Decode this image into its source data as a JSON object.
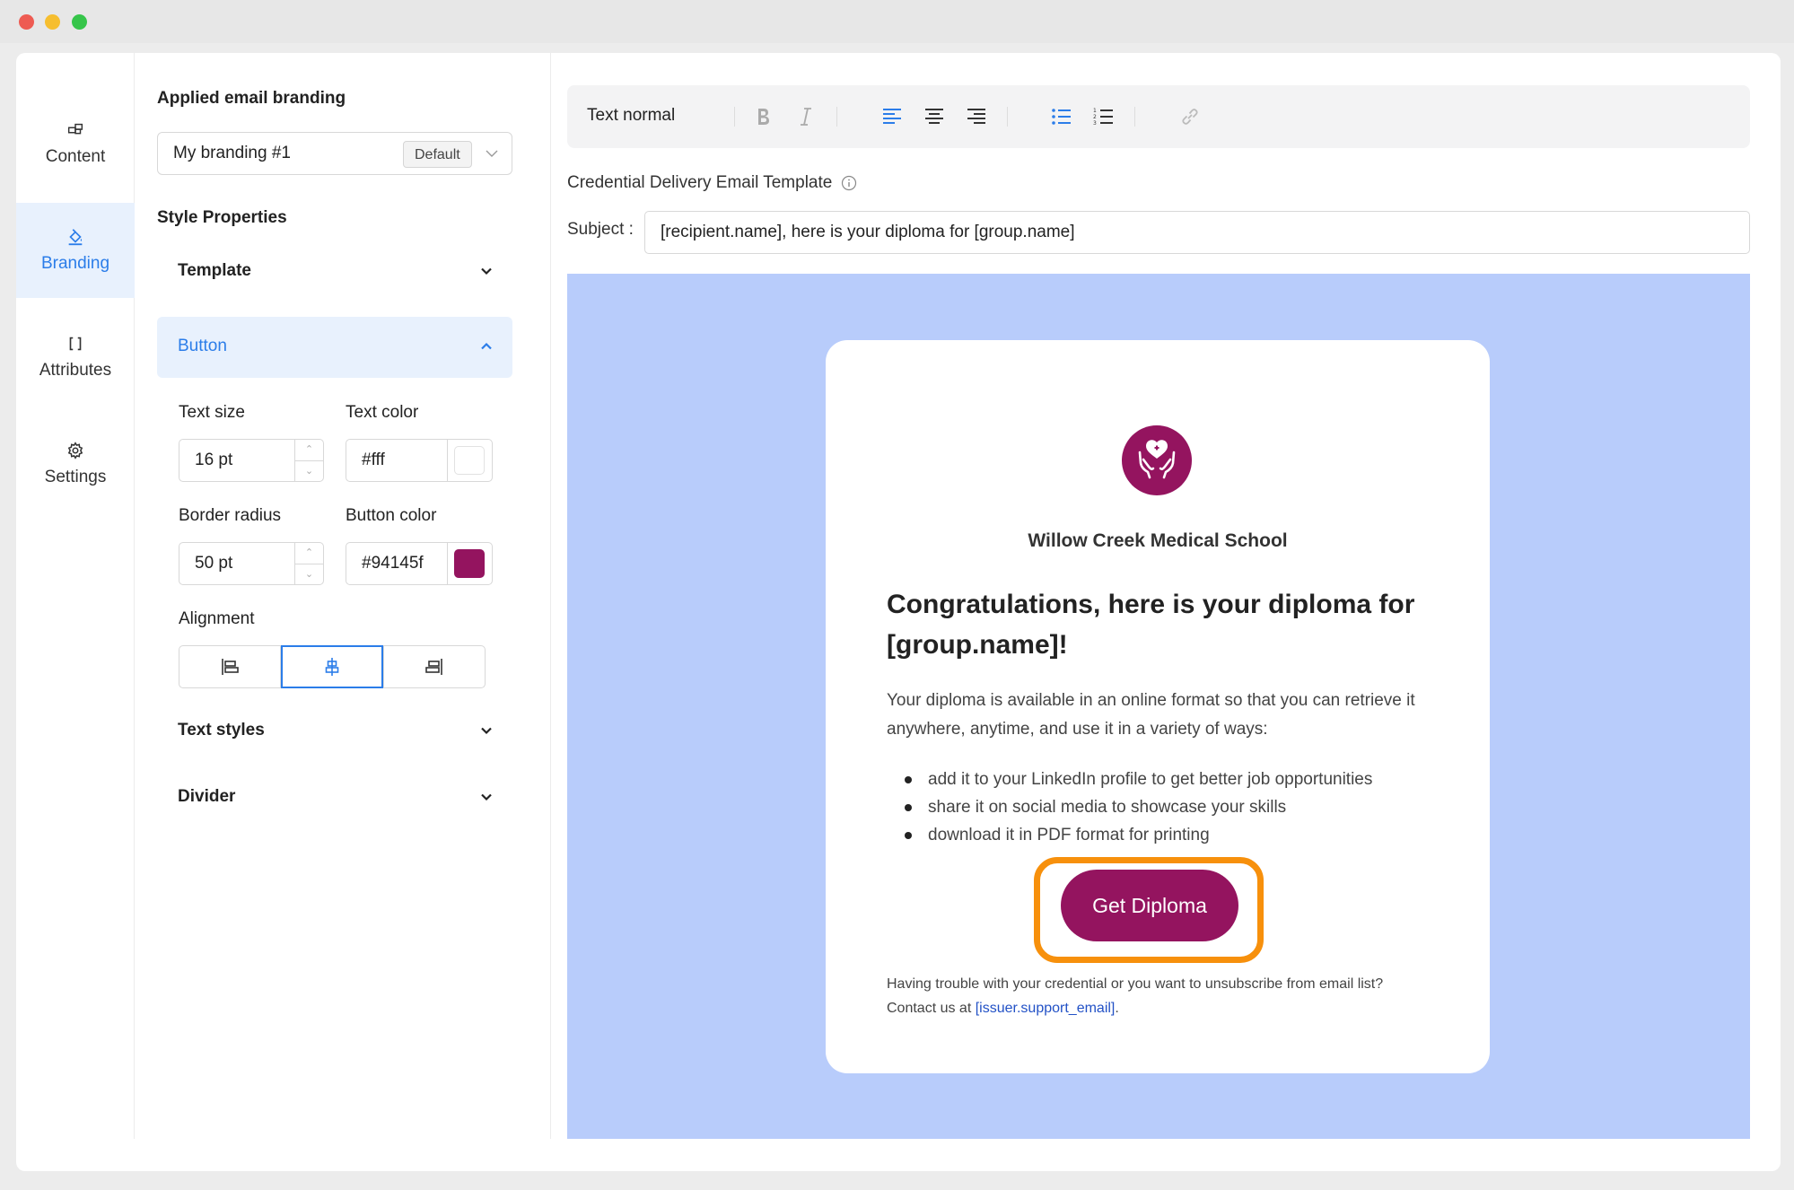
{
  "sidebar": {
    "items": [
      {
        "label": "Content",
        "icon": "content-blocks-icon"
      },
      {
        "label": "Branding",
        "icon": "paint-bucket-icon",
        "active": true
      },
      {
        "label": "Attributes",
        "icon": "brackets-icon"
      },
      {
        "label": "Settings",
        "icon": "gear-icon"
      }
    ]
  },
  "panel": {
    "branding_title": "Applied email branding",
    "branding_value": "My branding #1",
    "branding_badge": "Default",
    "style_title": "Style Properties",
    "sections": {
      "template": "Template",
      "button": "Button",
      "text_styles": "Text styles",
      "divider": "Divider"
    },
    "button": {
      "text_size_label": "Text size",
      "text_size": "16 pt",
      "text_color_label": "Text color",
      "text_color": "#fff",
      "border_radius_label": "Border radius",
      "border_radius": "50 pt",
      "button_color_label": "Button color",
      "button_color": "#94145f",
      "alignment_label": "Alignment",
      "alignment_selected": "center"
    }
  },
  "toolbar": {
    "text_style": "Text normal",
    "buttons": [
      "bold-icon",
      "italic-icon",
      "align-left-icon",
      "align-center-icon",
      "align-right-icon",
      "bullet-list-icon",
      "numbered-list-icon",
      "link-icon"
    ]
  },
  "template": {
    "title": "Credential Delivery Email Template",
    "subject_label": "Subject :",
    "subject": "[recipient.name], here is your diploma for [group.name]"
  },
  "email": {
    "school": "Willow Creek Medical School",
    "headline": "Congratulations, here is your diploma for [group.name]!",
    "intro": "Your diploma is available in an online format so that you can retrieve it anywhere, anytime, and use it in a variety of ways:",
    "ways": [
      "add it to your LinkedIn profile to get better job opportunities",
      "share it on social media to showcase your skills",
      "download it in PDF format for printing"
    ],
    "cta": "Get Diploma",
    "footnote": "Having trouble with your credential or you want to unsubscribe from email list? Contact us at",
    "support_link": "[issuer.support_email]",
    "footnote_end": "."
  },
  "colors": {
    "accent": "#2b7de9",
    "brand": "#94145f",
    "preview_bg": "#b8ccfb",
    "highlight": "#f7900c"
  }
}
